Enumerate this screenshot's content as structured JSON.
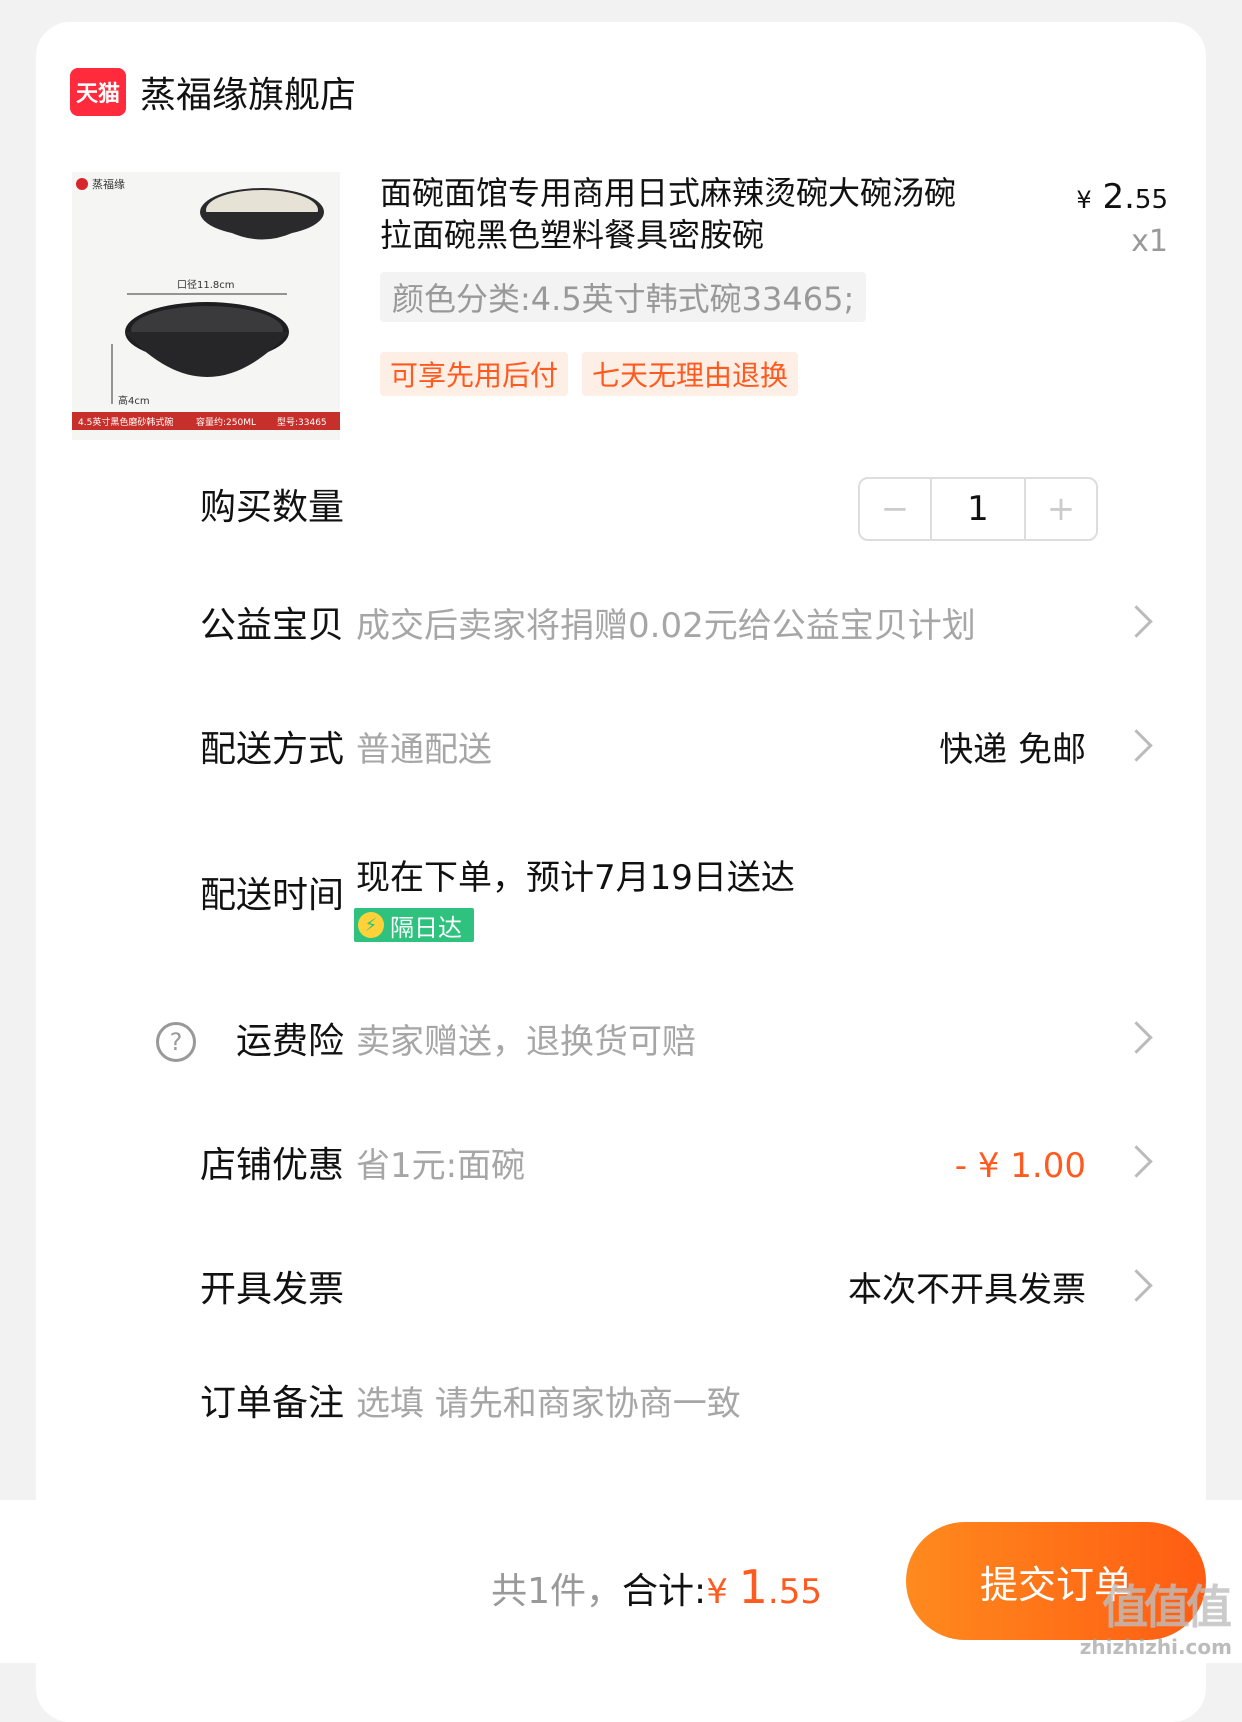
{
  "shop": {
    "logo_text": "天猫",
    "name": "蒸福缘旗舰店"
  },
  "product": {
    "image_labels": {
      "brand": "蒸福缘",
      "diameter": "口径11.8cm",
      "height": "高4cm",
      "footer_name": "4.5英寸黑色磨砂韩式碗",
      "footer_capacity": "容量约:250ML",
      "footer_model": "型号:33465"
    },
    "title": "面碗面馆专用商用日式麻辣烫碗大碗汤碗拉面碗黑色塑料餐具密胺碗",
    "price_currency": "¥",
    "price_int": "2.",
    "price_dec": "55",
    "quantity_x": "x1",
    "sku": "颜色分类:4.5英寸韩式碗33465;",
    "tags": [
      "可享先用后付",
      "七天无理由退换"
    ]
  },
  "rows": {
    "quantity": {
      "label": "购买数量",
      "minus": "−",
      "value": "1",
      "plus": "+"
    },
    "charity": {
      "label": "公益宝贝",
      "desc": "成交后卖家将捐赠0.02元给公益宝贝计划"
    },
    "shipping": {
      "label": "配送方式",
      "desc": "普通配送",
      "value": "快递 免邮"
    },
    "delivery_time": {
      "label": "配送时间",
      "text": "现在下单，预计7月19日送达",
      "badge": "隔日达"
    },
    "freight_insurance": {
      "label": "运费险",
      "desc": "卖家赠送，退换货可赔",
      "help": "?"
    },
    "shop_discount": {
      "label": "店铺优惠",
      "desc": "省1元:面碗",
      "value": "- ¥ 1.00"
    },
    "invoice": {
      "label": "开具发票",
      "value": "本次不开具发票"
    },
    "note": {
      "label": "订单备注",
      "placeholder": "选填 请先和商家协商一致"
    }
  },
  "footer": {
    "count": "共1件，",
    "total_label": "合计:",
    "currency": "¥ ",
    "amount_int": "1",
    "amount_dec": ".55",
    "submit": "提交订单",
    "watermark": "值值值",
    "watermark_url": "zhizhizhi.com"
  },
  "colors": {
    "accent": "#ff5a1f",
    "nextday": "#2ec27e",
    "tmall": "#ff2a3b"
  }
}
